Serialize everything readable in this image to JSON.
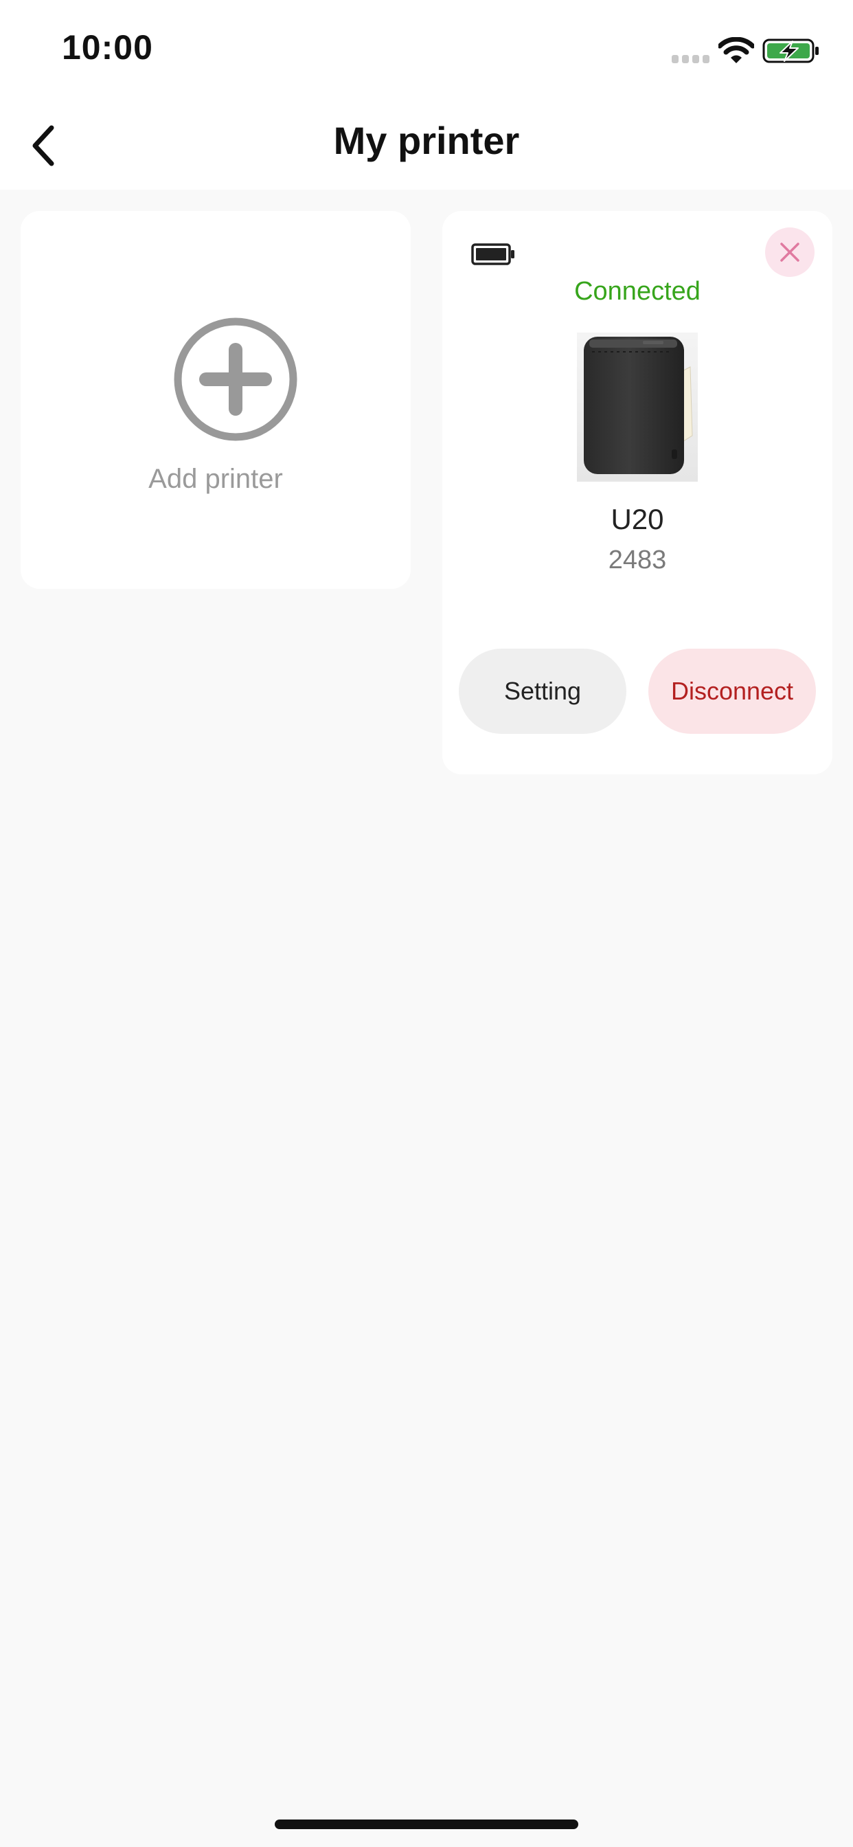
{
  "status_bar": {
    "time": "10:00"
  },
  "header": {
    "title": "My printer",
    "back_icon": "chevron-left-icon"
  },
  "add_card": {
    "icon": "plus-circle-icon",
    "label": "Add printer"
  },
  "printer": {
    "status": "Connected",
    "model": "U20",
    "serial": "2483",
    "battery_icon": "battery-icon",
    "close_icon": "close-icon",
    "setting_label": "Setting",
    "disconnect_label": "Disconnect"
  },
  "colors": {
    "connected": "#37a51c",
    "disconnect_text": "#b32020",
    "disconnect_bg": "#fbe4e7",
    "close_bg": "#fbe4ec",
    "close_x": "#e07aa0",
    "setting_bg": "#efefef",
    "page_bg": "#f9f9f9",
    "add_icon": "#999999",
    "status_battery": "#3da84a"
  }
}
